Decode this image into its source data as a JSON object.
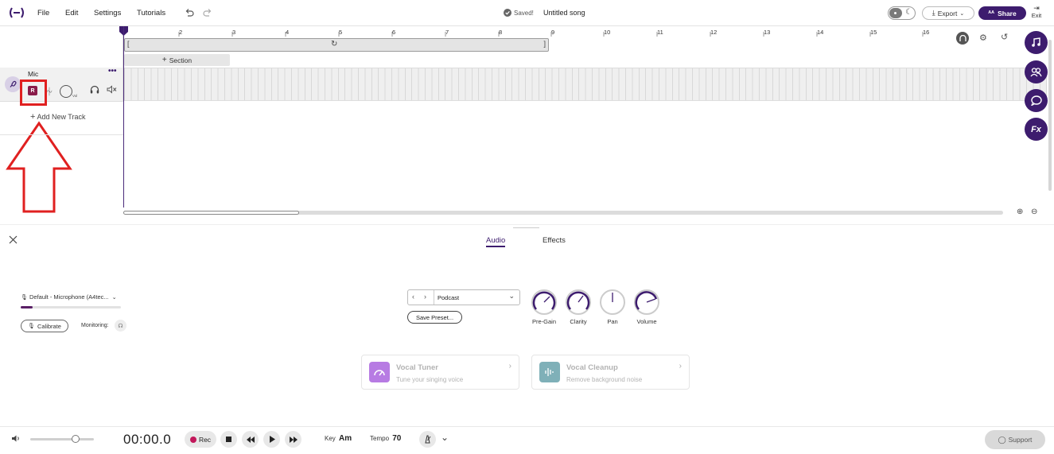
{
  "menu": [
    "File",
    "Edit",
    "Settings",
    "Tutorials"
  ],
  "status": {
    "saved": "Saved!",
    "song_title": "Untitled song"
  },
  "actions": {
    "export": "Export",
    "share": "Share",
    "exit": "Exit"
  },
  "ruler": {
    "ticks": [
      "2",
      "3",
      "4",
      "5",
      "6",
      "7",
      "8",
      "9",
      "10",
      "11",
      "12",
      "13",
      "14",
      "15",
      "16"
    ]
  },
  "arrangement": {
    "section_label": "Section"
  },
  "track": {
    "name": "Mic",
    "record_badge": "R",
    "vol_label": "Vol",
    "add_track": "Add New Track"
  },
  "right_rail": {
    "icons": [
      "music-note-icon",
      "collab-icon",
      "chat-icon",
      "fx-icon"
    ],
    "fx_label": "Fx"
  },
  "panel": {
    "tabs": [
      "Audio",
      "Effects"
    ],
    "active_tab": "Audio",
    "input_device": "Default - Microphone (A4tec...",
    "calibrate": "Calibrate",
    "monitoring": "Monitoring:",
    "preset": "Podcast",
    "save_preset": "Save Preset...",
    "knobs": [
      "Pre-Gain",
      "Clarity",
      "Pan",
      "Volume"
    ],
    "cards": [
      {
        "title": "Vocal Tuner",
        "subtitle": "Tune your singing voice",
        "color": "#b77be3"
      },
      {
        "title": "Vocal Cleanup",
        "subtitle": "Remove background noise",
        "color": "#7fb0b8"
      }
    ]
  },
  "transport": {
    "time": "00:00.0",
    "rec": "Rec",
    "key_label": "Key",
    "key_value": "Am",
    "tempo_label": "Tempo",
    "tempo_value": "70",
    "support": "Support"
  },
  "colors": {
    "accent": "#3d1c6e",
    "annotation": "#e02020",
    "rec_dot": "#c2185b"
  }
}
